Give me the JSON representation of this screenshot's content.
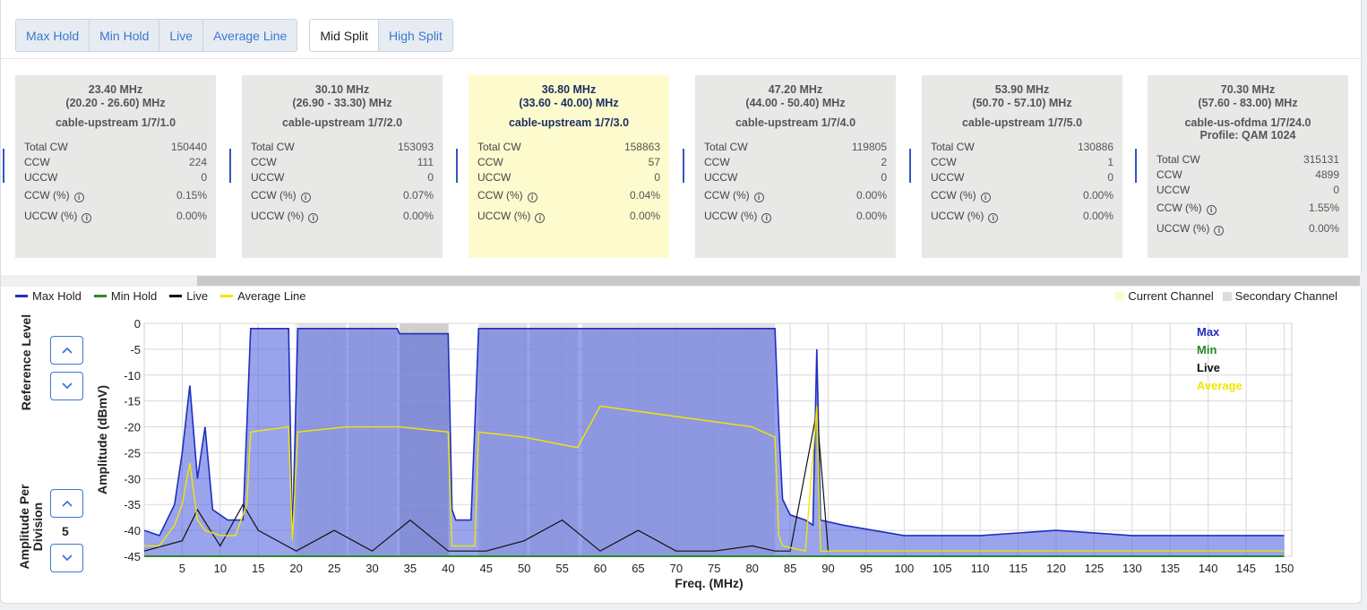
{
  "toolbar": {
    "trace_buttons": [
      "Max Hold",
      "Min Hold",
      "Live",
      "Average Line"
    ],
    "split_buttons": [
      "Mid Split",
      "High Split"
    ],
    "active_split": "Mid Split"
  },
  "channels": [
    {
      "freq": "23.40 MHz",
      "range": "(20.20 - 26.60) MHz",
      "iface": "cable-upstream 1/7/1.0",
      "profile": "",
      "total_cw": "150440",
      "ccw": "224",
      "uccw": "0",
      "ccw_pct": "0.15%",
      "uccw_pct": "0.00%",
      "current": false
    },
    {
      "freq": "30.10 MHz",
      "range": "(26.90 - 33.30) MHz",
      "iface": "cable-upstream 1/7/2.0",
      "profile": "",
      "total_cw": "153093",
      "ccw": "111",
      "uccw": "0",
      "ccw_pct": "0.07%",
      "uccw_pct": "0.00%",
      "current": false
    },
    {
      "freq": "36.80 MHz",
      "range": "(33.60 - 40.00) MHz",
      "iface": "cable-upstream 1/7/3.0",
      "profile": "",
      "total_cw": "158863",
      "ccw": "57",
      "uccw": "0",
      "ccw_pct": "0.04%",
      "uccw_pct": "0.00%",
      "current": true
    },
    {
      "freq": "47.20 MHz",
      "range": "(44.00 - 50.40) MHz",
      "iface": "cable-upstream 1/7/4.0",
      "profile": "",
      "total_cw": "119805",
      "ccw": "2",
      "uccw": "0",
      "ccw_pct": "0.00%",
      "uccw_pct": "0.00%",
      "current": false
    },
    {
      "freq": "53.90 MHz",
      "range": "(50.70 - 57.10) MHz",
      "iface": "cable-upstream 1/7/5.0",
      "profile": "",
      "total_cw": "130886",
      "ccw": "1",
      "uccw": "0",
      "ccw_pct": "0.00%",
      "uccw_pct": "0.00%",
      "current": false
    },
    {
      "freq": "70.30 MHz",
      "range": "(57.60 - 83.00) MHz",
      "iface": "cable-us-ofdma 1/7/24.0",
      "profile": "Profile: QAM 1024",
      "total_cw": "315131",
      "ccw": "4899",
      "uccw": "0",
      "ccw_pct": "1.55%",
      "uccw_pct": "0.00%",
      "current": false
    }
  ],
  "row_labels": {
    "total_cw": "Total CW",
    "ccw": "CCW",
    "uccw": "UCCW",
    "ccw_pct": "CCW (%)",
    "uccw_pct": "UCCW (%)"
  },
  "legend": {
    "traces": [
      {
        "label": "Max Hold",
        "color": "#1f2fbf"
      },
      {
        "label": "Min Hold",
        "color": "#2a8a2a"
      },
      {
        "label": "Live",
        "color": "#111111"
      },
      {
        "label": "Average Line",
        "color": "#f2e600"
      }
    ],
    "channels": [
      {
        "label": "Current Channel",
        "color": "#fdfbcd"
      },
      {
        "label": "Secondary Channel",
        "color": "#dcdcdc"
      }
    ]
  },
  "controls": {
    "reference_level_label": "Reference Level",
    "amplitude_per_division_label": "Amplitude Per Division",
    "amplitude_per_division_value": "5"
  },
  "chart_data": {
    "type": "line",
    "xlabel": "Freq. (MHz)",
    "ylabel": "Amplitude (dBmV)",
    "xlim": [
      0,
      151
    ],
    "ylim": [
      -45,
      0
    ],
    "xticks": [
      5,
      10,
      15,
      20,
      25,
      30,
      35,
      40,
      45,
      50,
      55,
      60,
      65,
      70,
      75,
      80,
      85,
      90,
      95,
      100,
      105,
      110,
      115,
      120,
      125,
      130,
      135,
      140,
      145,
      150
    ],
    "yticks": [
      0,
      -5,
      -10,
      -15,
      -20,
      -25,
      -30,
      -35,
      -40,
      -45
    ],
    "inline_legend": [
      {
        "label": "Max",
        "color": "#1f2fbf"
      },
      {
        "label": "Min",
        "color": "#2a8a2a"
      },
      {
        "label": "Live",
        "color": "#111111"
      },
      {
        "label": "Average",
        "color": "#f2e600"
      }
    ],
    "current_channel_range": [
      33.6,
      40.0
    ],
    "secondary_channel_ranges": [
      [
        20.2,
        26.6
      ],
      [
        26.9,
        33.3
      ],
      [
        44.0,
        50.4
      ],
      [
        50.7,
        57.1
      ],
      [
        57.6,
        83.0
      ]
    ],
    "series": [
      {
        "name": "Max",
        "x": [
          0,
          2,
          4,
          5,
          6,
          7,
          8,
          9,
          10,
          11,
          12,
          13,
          13.5,
          14,
          19,
          19.5,
          20.2,
          26.6,
          26.9,
          33.3,
          33.6,
          40.0,
          40.5,
          41,
          43,
          43.5,
          44,
          83,
          83.5,
          84,
          85,
          87,
          88,
          88.5,
          89,
          92,
          100,
          110,
          120,
          130,
          140,
          150
        ],
        "y": [
          -40,
          -41,
          -35,
          -25,
          -12,
          -30,
          -20,
          -36,
          -37,
          -38,
          -38,
          -38,
          -20,
          -1,
          -1,
          -42,
          -1,
          -1,
          -1,
          -1,
          -2,
          -2,
          -36,
          -38,
          -38,
          -20,
          -1,
          -1,
          -20,
          -34,
          -37,
          -38,
          -39,
          -5,
          -38,
          -39,
          -41,
          -41,
          -40,
          -41,
          -41,
          -41
        ]
      },
      {
        "name": "Average",
        "x": [
          0,
          2,
          4,
          5,
          6,
          7,
          8,
          10,
          12,
          13.5,
          14,
          19,
          19.5,
          20.2,
          26.6,
          26.9,
          33.3,
          33.6,
          40.0,
          40.5,
          43.5,
          44,
          50,
          57,
          60,
          70,
          80,
          83,
          83.5,
          84,
          87,
          88.5,
          89,
          92,
          150
        ],
        "y": [
          -43,
          -43,
          -39,
          -35,
          -27,
          -38,
          -40,
          -41,
          -41,
          -35,
          -21,
          -20,
          -42,
          -21,
          -20,
          -20,
          -20,
          -20,
          -21,
          -43,
          -43,
          -21,
          -22,
          -24,
          -16,
          -18,
          -20,
          -22,
          -41,
          -43,
          -44,
          -16,
          -44,
          -44,
          -44
        ]
      },
      {
        "name": "Live",
        "x": [
          0,
          5,
          7,
          10,
          13,
          15,
          20,
          25,
          30,
          35,
          40,
          45,
          50,
          55,
          60,
          65,
          70,
          75,
          80,
          83,
          85,
          88.5,
          90,
          150
        ],
        "y": [
          -44,
          -42,
          -36,
          -43,
          -35,
          -40,
          -44,
          -40,
          -44,
          -38,
          -44,
          -44,
          -42,
          -38,
          -44,
          -40,
          -44,
          -44,
          -43,
          -44,
          -44,
          -17,
          -44,
          -44
        ]
      },
      {
        "name": "Min",
        "x": [
          0,
          150
        ],
        "y": [
          -45,
          -45
        ]
      }
    ]
  }
}
